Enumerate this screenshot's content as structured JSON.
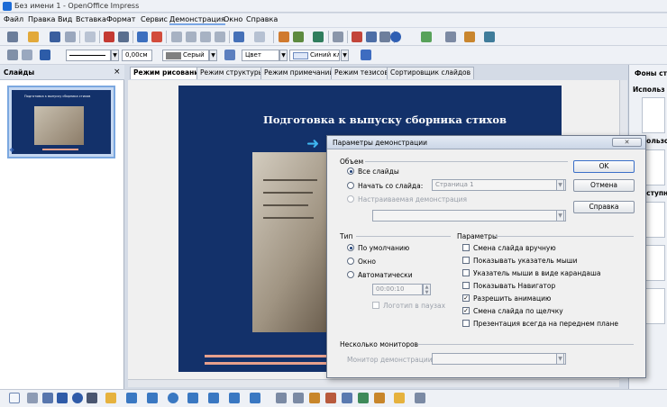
{
  "window": {
    "title": "Без имени 1 - OpenOffice Impress"
  },
  "menu": [
    "Файл",
    "Правка",
    "Вид",
    "Вставка",
    "Формат",
    "Сервис",
    "Демонстрация",
    "Окно",
    "Справка"
  ],
  "format_toolbar": {
    "line_width": "0,00см",
    "fill_color": "Серый",
    "area_style": "Цвет",
    "line_color": "Синий кла"
  },
  "slides_panel": {
    "title": "Слайды",
    "close": "×",
    "slide_number": "1",
    "thumb_title": "Подготовка к выпуску сборника стихов"
  },
  "tabs": [
    "Режим рисования",
    "Режим структуры",
    "Режим примечаний",
    "Режим тезисов",
    "Сортировщик слайдов"
  ],
  "slide": {
    "title": "Подготовка к выпуску сборника стихов"
  },
  "right_panel": {
    "title": "Фоны стр",
    "section1": "Использ",
    "section2": "пользо",
    "section3": "оступн"
  },
  "dialog": {
    "title": "Параметры демонстрации",
    "close": "✕",
    "scope": {
      "heading": "Объем",
      "all_slides": "Все слайды",
      "start_from": "Начать со слайда:",
      "start_value": "Страница 1",
      "custom": "Настраиваемая демонстрация",
      "custom_value": ""
    },
    "type": {
      "heading": "Тип",
      "default": "По умолчанию",
      "window": "Окно",
      "auto": "Автоматически",
      "pause": "00:00:10",
      "logo": "Логотип в паузах"
    },
    "options": {
      "heading": "Параметры",
      "items": [
        {
          "label": "Смена слайда вручную",
          "checked": false
        },
        {
          "label": "Показывать указатель мыши",
          "checked": false
        },
        {
          "label": "Указатель мыши в виде карандаша",
          "checked": false
        },
        {
          "label": "Показывать Навигатор",
          "checked": false
        },
        {
          "label": "Разрешить анимацию",
          "checked": true
        },
        {
          "label": "Смена слайда по щелчку",
          "checked": true
        },
        {
          "label": "Презентация всегда на переднем плане",
          "checked": false
        }
      ]
    },
    "monitors": {
      "heading": "Несколько мониторов",
      "label": "Монитор демонстрации",
      "value": ""
    },
    "buttons": {
      "ok": "OK",
      "cancel": "Отмена",
      "help": "Справка"
    }
  },
  "colors": {
    "slide_bg": "#13316a",
    "accent_bar": "#e8a08c",
    "arrow": "#3fb6f0"
  }
}
